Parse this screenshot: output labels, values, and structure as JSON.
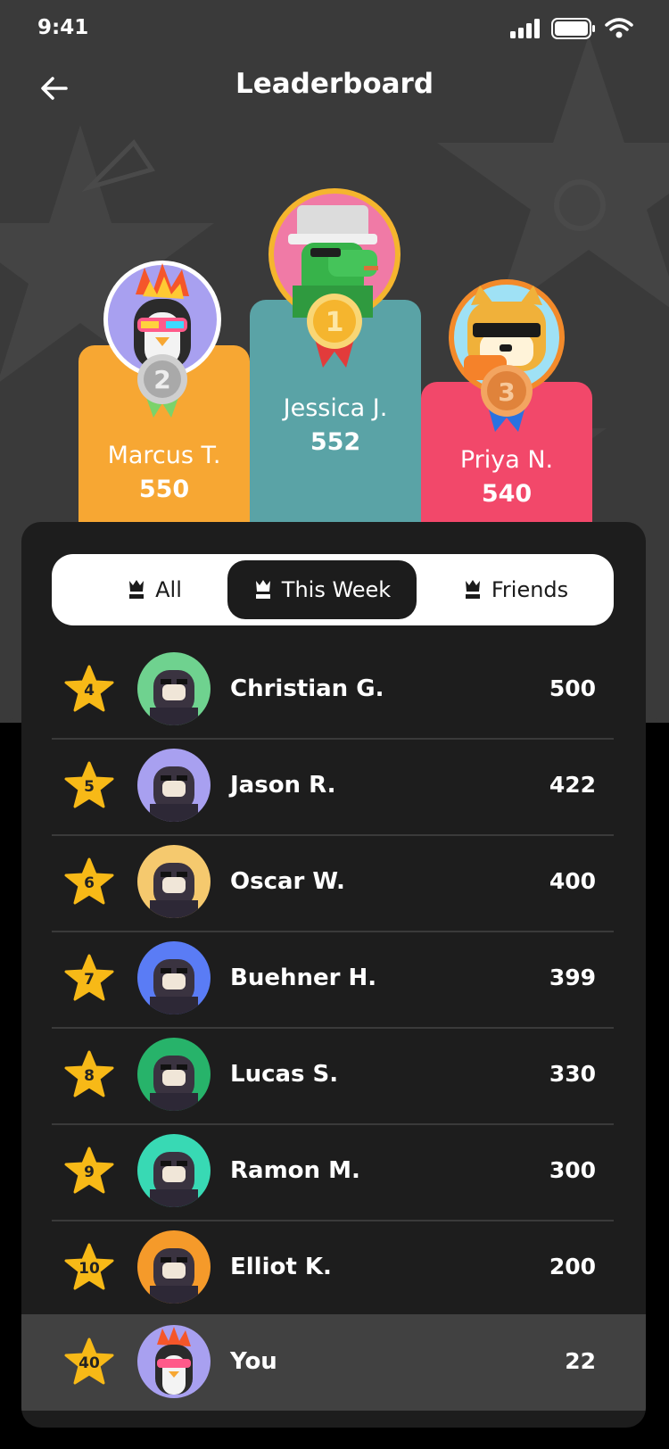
{
  "status": {
    "time": "9:41"
  },
  "header": {
    "title": "Leaderboard"
  },
  "podium": [
    {
      "place": "2",
      "name": "Marcus T.",
      "score": "550",
      "color": "#f7a733"
    },
    {
      "place": "1",
      "name": "Jessica J.",
      "score": "552",
      "color": "#5aa3a6"
    },
    {
      "place": "3",
      "name": "Priya N.",
      "score": "540",
      "color": "#f2486a"
    }
  ],
  "tabs": [
    {
      "label": "All"
    },
    {
      "label": "This Week",
      "active": true
    },
    {
      "label": "Friends"
    }
  ],
  "rows": [
    {
      "rank": "4",
      "name": "Christian G.",
      "score": "500",
      "avatar_bg": "#6fd28f"
    },
    {
      "rank": "5",
      "name": "Jason R.",
      "score": "422",
      "avatar_bg": "#a8a0f0"
    },
    {
      "rank": "6",
      "name": "Oscar W.",
      "score": "400",
      "avatar_bg": "#f5c96e"
    },
    {
      "rank": "7",
      "name": "Buehner H.",
      "score": "399",
      "avatar_bg": "#5a7cf5"
    },
    {
      "rank": "8",
      "name": "Lucas S.",
      "score": "330",
      "avatar_bg": "#27b36a"
    },
    {
      "rank": "9",
      "name": "Ramon M.",
      "score": "300",
      "avatar_bg": "#38d9b4"
    },
    {
      "rank": "10",
      "name": "Elliot K.",
      "score": "200",
      "avatar_bg": "#f59a2a"
    }
  ],
  "you": {
    "rank": "40",
    "name": "You",
    "score": "22",
    "avatar_bg": "#a8a0f0"
  },
  "colors": {
    "star": "#f7b917",
    "gold": "#f5b52e",
    "silver": "#b9b9b9",
    "bronze": "#e0833b"
  }
}
